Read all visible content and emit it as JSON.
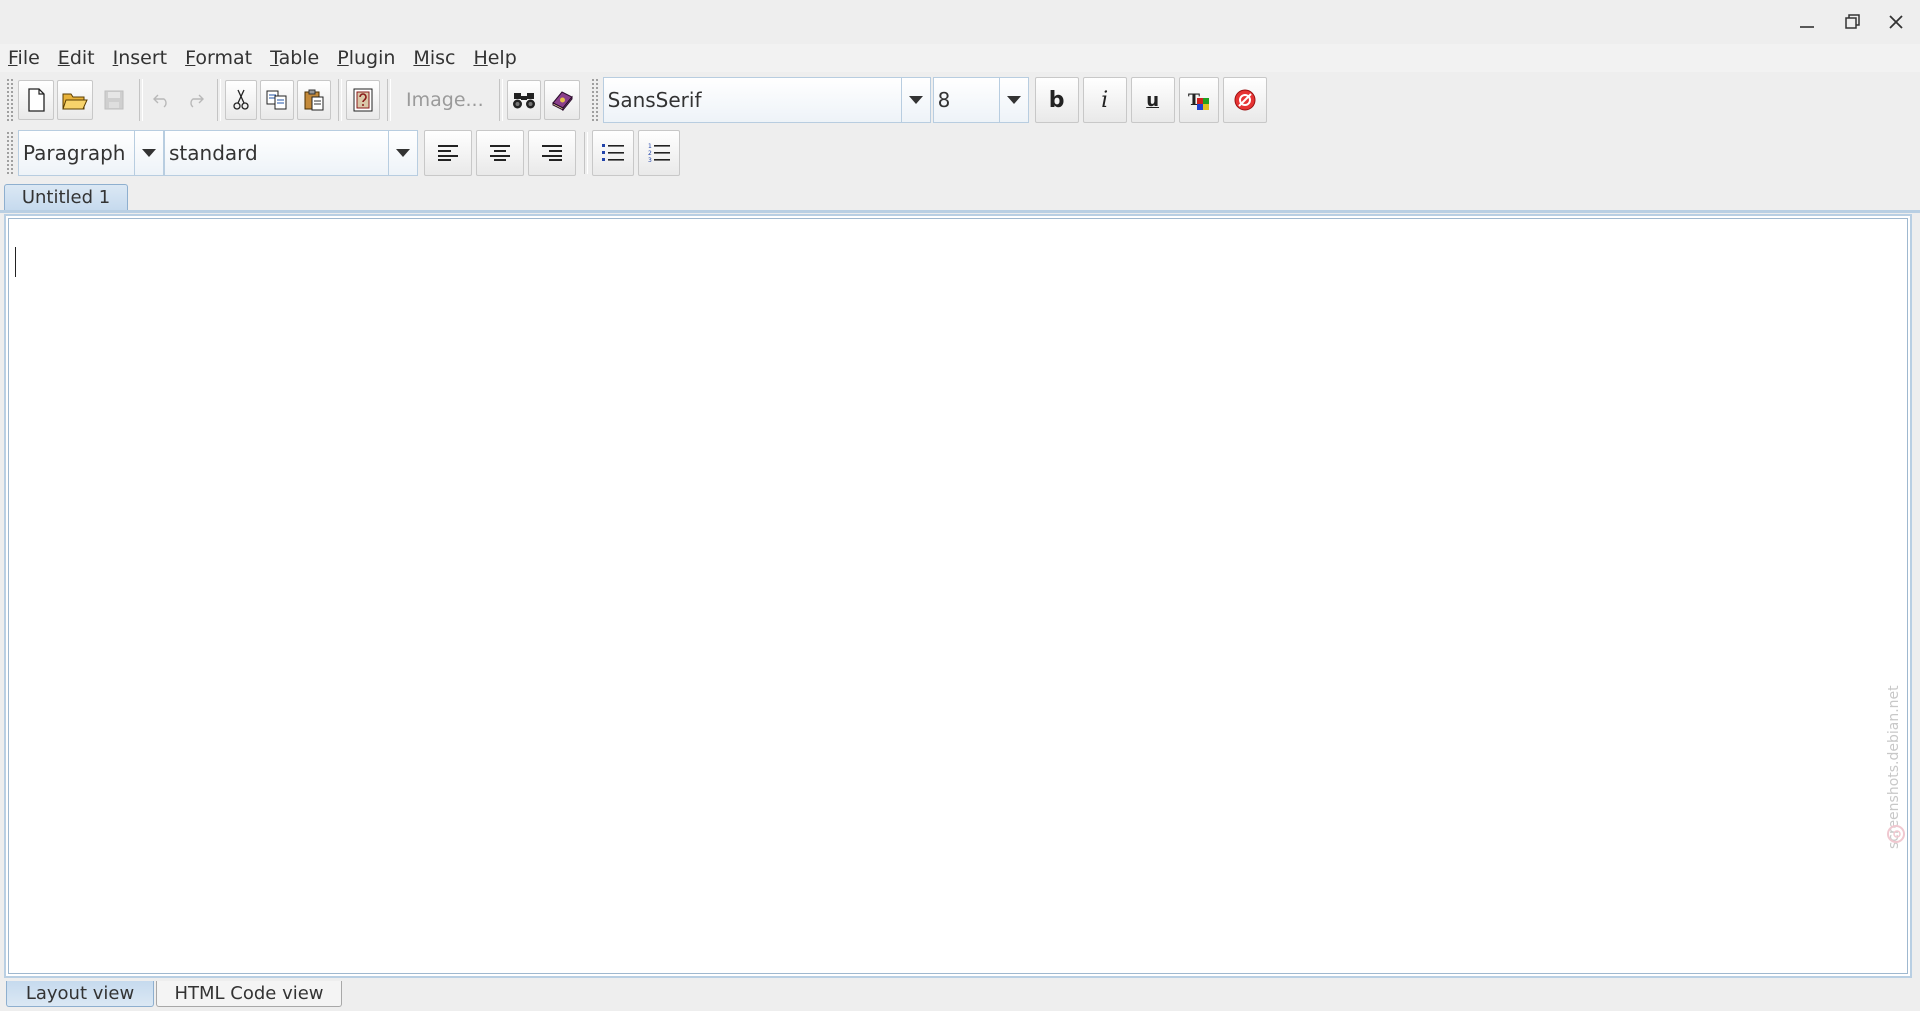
{
  "window": {
    "minimize_icon": "minimize-icon",
    "maximize_icon": "maximize-icon",
    "close_icon": "close-icon"
  },
  "menubar": {
    "items": [
      {
        "mnemonic": "F",
        "rest": "ile"
      },
      {
        "mnemonic": "E",
        "rest": "dit"
      },
      {
        "mnemonic": "I",
        "rest": "nsert"
      },
      {
        "mnemonic": "F",
        "rest": "ormat"
      },
      {
        "mnemonic": "T",
        "rest": "able"
      },
      {
        "mnemonic": "P",
        "rest": "lugin"
      },
      {
        "mnemonic": "M",
        "rest": "isc"
      },
      {
        "mnemonic": "H",
        "rest": "elp"
      }
    ]
  },
  "toolbar1": {
    "image_label": "Image...",
    "font_family": "SansSerif",
    "font_size": "8",
    "bold_label": "b",
    "italic_label": "i",
    "underline_label": "u"
  },
  "toolbar2": {
    "paragraph_type": "Paragraph",
    "style_value": "standard"
  },
  "document": {
    "tab_label": "Untitled 1",
    "content": ""
  },
  "watermark": {
    "text": "screenshots.debian.net"
  },
  "bottom_tabs": {
    "layout_view": "Layout view",
    "html_code_view": "HTML Code view",
    "active": "Layout view"
  },
  "colors": {
    "accent": "#b9cfe3",
    "tab_active": "#c6daee",
    "background": "#eeeeee"
  }
}
